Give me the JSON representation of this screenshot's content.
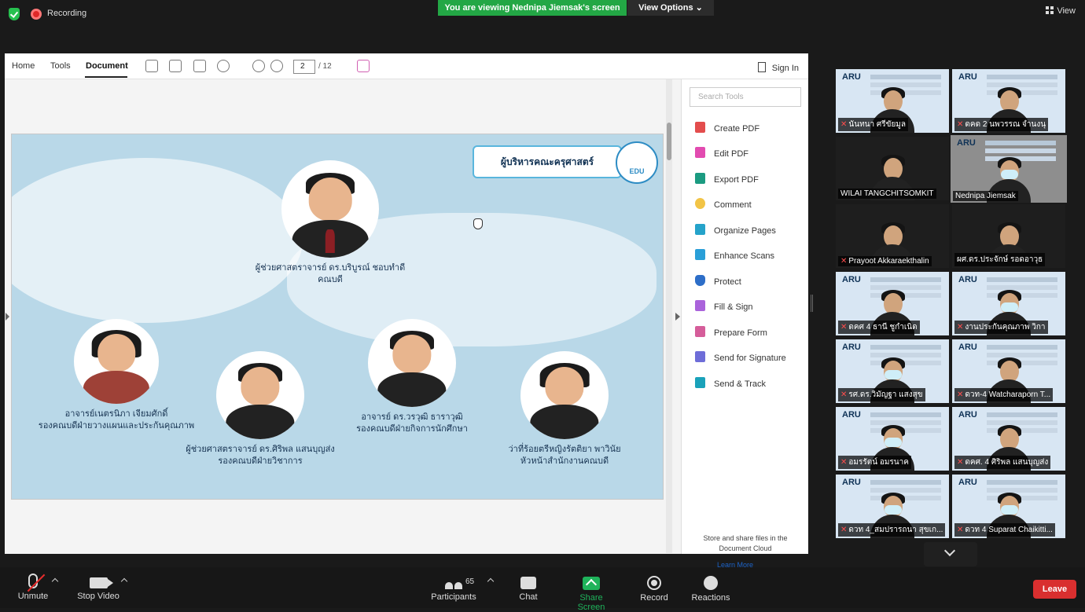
{
  "app": {
    "recording_label": "Recording",
    "viewing_banner": "You are viewing Nednipa Jiemsak's screen",
    "view_options": "View Options",
    "view_button": "View"
  },
  "pdf": {
    "menu": [
      "Home",
      "Tools",
      "Document"
    ],
    "page_current": "2",
    "page_total": "/ 12",
    "sign_in": "Sign In",
    "search_placeholder": "Search Tools",
    "tools": [
      {
        "label": "Create PDF",
        "color": "#e34d4d"
      },
      {
        "label": "Edit PDF",
        "color": "#e24bb0"
      },
      {
        "label": "Export PDF",
        "color": "#1b9b81"
      },
      {
        "label": "Comment",
        "color": "#f2c446"
      },
      {
        "label": "Organize Pages",
        "color": "#25a3ca"
      },
      {
        "label": "Enhance Scans",
        "color": "#2a9fd8"
      },
      {
        "label": "Protect",
        "color": "#2d6ec8"
      },
      {
        "label": "Fill & Sign",
        "color": "#aa63db"
      },
      {
        "label": "Prepare Form",
        "color": "#d55d9a"
      },
      {
        "label": "Send for Signature",
        "color": "#6e6dd8"
      },
      {
        "label": "Send & Track",
        "color": "#1aa2ba"
      }
    ],
    "cloud_text": "Store and share files in the Document Cloud",
    "learn_more": "Learn More"
  },
  "slide": {
    "title": "ผู้บริหารคณะครุศาสตร์",
    "logo_text": "EDU",
    "dean": {
      "name": "ผู้ช่วยศาสตราจารย์ ดร.บริบูรณ์ ชอบทำดี",
      "role": "คณบดี"
    },
    "people": [
      {
        "name": "อาจารย์เนตรนิภา เจียมศักดิ์",
        "role": "รองคณบดีฝ่ายวางแผนและประกันคุณภาพ"
      },
      {
        "name": "ผู้ช่วยศาสตราจารย์ ดร.ศิริพล แสนบุญส่ง",
        "role": "รองคณบดีฝ่ายวิชาการ"
      },
      {
        "name": "อาจารย์ ดร.วรวุฒิ ธาราวุฒิ",
        "role": "รองคณบดีฝ่ายกิจการนักศึกษา"
      },
      {
        "name": "ว่าที่ร้อยตรีหญิงรัตติยา พาวินัย",
        "role": "หัวหน้าสำนักงานคณบดี"
      }
    ]
  },
  "participants": [
    {
      "name": "นันทนา ศรีขัยมูล",
      "muted": true
    },
    {
      "name": "ดคด 2 นพวรรณ จำนงนุ",
      "muted": true
    },
    {
      "name": "WILAI TANGCHITSOMKIT",
      "muted": false
    },
    {
      "name": "Nednipa Jiemsak",
      "muted": false
    },
    {
      "name": "Prayoot Akkaraekthalin",
      "muted": true
    },
    {
      "name": "ผศ.ดร.ประจักษ์ รอดอาวุธ",
      "muted": false
    },
    {
      "name": "ดคศ 4 ธานี ชูกำเนิด",
      "muted": true
    },
    {
      "name": "งานประกันคุณภาพ วิกา",
      "muted": true
    },
    {
      "name": "รศ.ดร.วิมัญฐา แสงสุข",
      "muted": true
    },
    {
      "name": "ดวท-4 Watcharaporn T...",
      "muted": true
    },
    {
      "name": "อมรรัตน์ อมรนาค",
      "muted": true
    },
    {
      "name": "ดคศ. 4 ศิริพล แสนบุญส่ง",
      "muted": true
    },
    {
      "name": "ดวท 4_สมปรารถนา สุขเก...",
      "muted": true
    },
    {
      "name": "ดวท 4 Suparat Chaikitti...",
      "muted": true
    }
  ],
  "controls": {
    "unmute": "Unmute",
    "stop_video": "Stop Video",
    "participant_count": "65",
    "participants": "Participants",
    "chat": "Chat",
    "share_screen": "Share Screen",
    "record": "Record",
    "reactions": "Reactions",
    "leave": "Leave"
  }
}
